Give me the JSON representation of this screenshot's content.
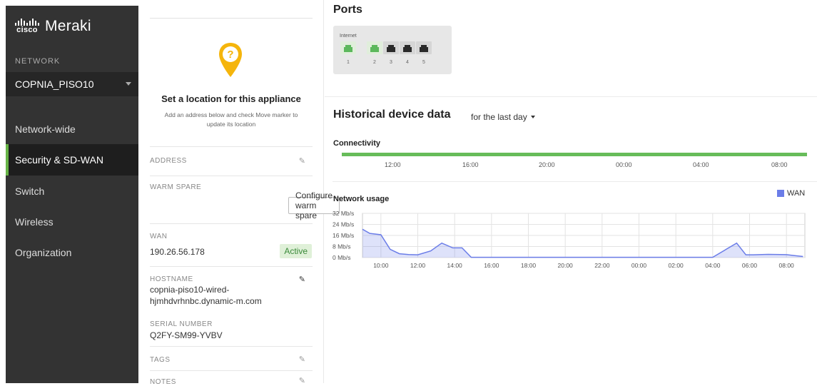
{
  "brand": {
    "cisco": "cisco",
    "product": "Meraki"
  },
  "sidebar": {
    "network_label": "NETWORK",
    "network_selected": "COPNIA_PISO10",
    "items": [
      {
        "label": "Network-wide"
      },
      {
        "label": "Security & SD-WAN",
        "active": true
      },
      {
        "label": "Switch"
      },
      {
        "label": "Wireless"
      },
      {
        "label": "Organization"
      }
    ]
  },
  "location": {
    "title": "Set a location for this appliance",
    "subtitle": "Add an address below and check Move marker to update its location"
  },
  "details": {
    "address_label": "ADDRESS",
    "warm_spare_label": "WARM SPARE",
    "warm_spare_button": "Configure warm spare",
    "wan_label": "WAN",
    "wan_ip": "190.26.56.178",
    "wan_status": "Active",
    "hostname_label": "HOSTNAME",
    "hostname_line1": "copnia-piso10-wired-",
    "hostname_line2": "hjmhdvrhnbc.dynamic-m.com",
    "serial_label": "SERIAL NUMBER",
    "serial_value": "Q2FY-SM99-YVBV",
    "tags_label": "TAGS",
    "notes_label": "NOTES"
  },
  "ports": {
    "title": "Ports",
    "internet_label": "Internet",
    "items": [
      {
        "num": "1",
        "status": "connected"
      },
      {
        "num": "2",
        "status": "connected"
      },
      {
        "num": "3",
        "status": "disconnected"
      },
      {
        "num": "4",
        "status": "disconnected"
      },
      {
        "num": "5",
        "status": "disconnected"
      }
    ]
  },
  "historical": {
    "title": "Historical device data",
    "range": "for the last day"
  },
  "connectivity": {
    "title": "Connectivity",
    "ticks": [
      "12:00",
      "16:00",
      "20:00",
      "00:00",
      "04:00",
      "08:00"
    ],
    "color": "#67bc5a"
  },
  "chart_data": {
    "type": "area",
    "title": "Network usage",
    "legend": "WAN",
    "legend_position": "top-right",
    "color": "#6b7de8",
    "ylim": [
      0,
      32
    ],
    "yticks": [
      "32 Mb/s",
      "24 Mb/s",
      "16 Mb/s",
      "8 Mb/s",
      "0 Mb/s"
    ],
    "xticks": [
      "10:00",
      "12:00",
      "14:00",
      "16:00",
      "18:00",
      "20:00",
      "22:00",
      "00:00",
      "02:00",
      "04:00",
      "06:00",
      "08:00"
    ],
    "series": [
      {
        "name": "WAN",
        "x": [
          9.0,
          9.4,
          10.0,
          10.5,
          11.0,
          11.5,
          12.0,
          12.7,
          13.3,
          13.9,
          14.4,
          14.9,
          15.7,
          18,
          20,
          22,
          24,
          26,
          28,
          29.3,
          29.8,
          30.2,
          31,
          32,
          32.4,
          32.9
        ],
        "values": [
          20.5,
          17.5,
          16.5,
          6,
          2.8,
          2.2,
          2.0,
          4.8,
          10.5,
          7.0,
          7.0,
          0.2,
          0.2,
          0.2,
          0.2,
          0.2,
          0.2,
          0.2,
          0.2,
          10.5,
          2.0,
          2.0,
          2.3,
          2.1,
          1.5,
          0.8
        ]
      }
    ]
  }
}
